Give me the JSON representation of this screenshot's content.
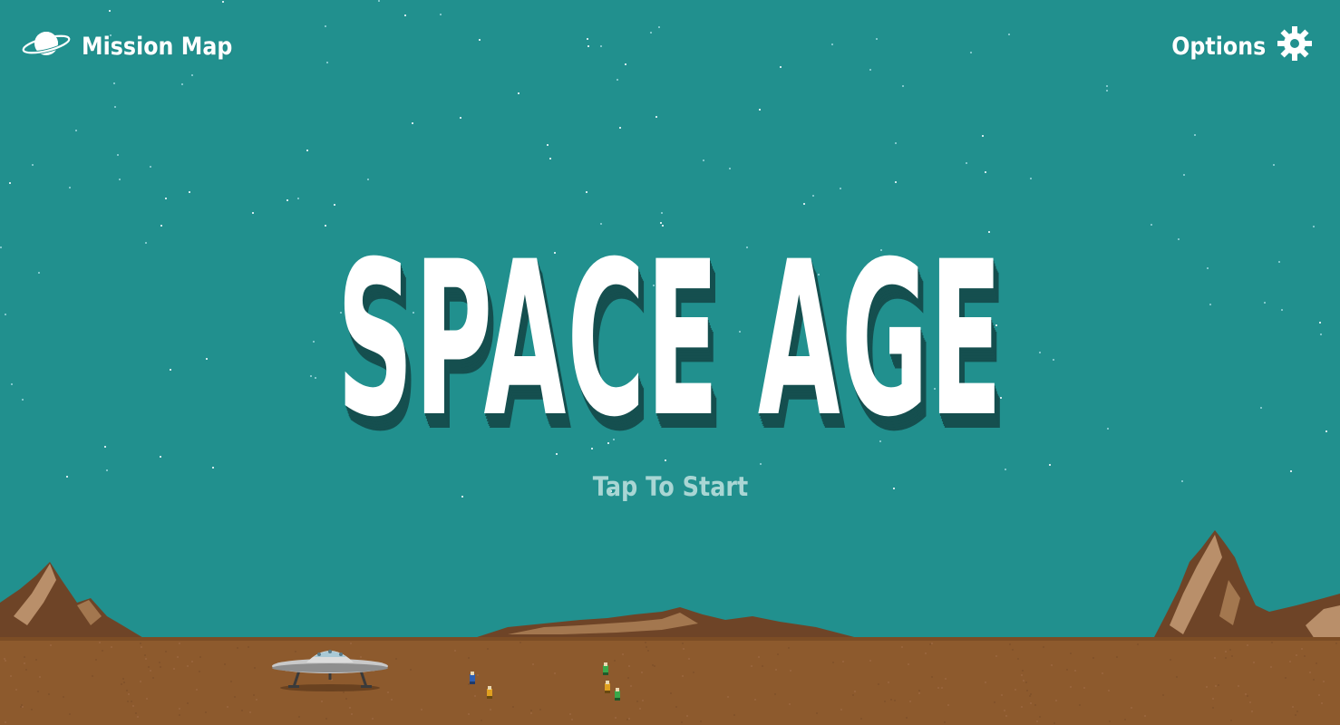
{
  "header": {
    "mission_map_label": "Mission Map",
    "mission_map_icon": "planet-icon",
    "options_label": "Options",
    "options_icon": "gear-icon"
  },
  "title": {
    "text": "SPACE AGE",
    "prompt": "Tap To Start"
  },
  "colors": {
    "sky": "#21908e",
    "ground": "#8d5a2d",
    "title_fill": "#ffffff",
    "title_shadow": "#154f4f",
    "prompt": "#a9d6d4",
    "mountain_dark": "#6e4427",
    "mountain_light": "#b98f6a"
  },
  "scene_objects": [
    "ufo-spaceship",
    "astronaut-blue",
    "astronaut-orange",
    "astronaut-green"
  ]
}
